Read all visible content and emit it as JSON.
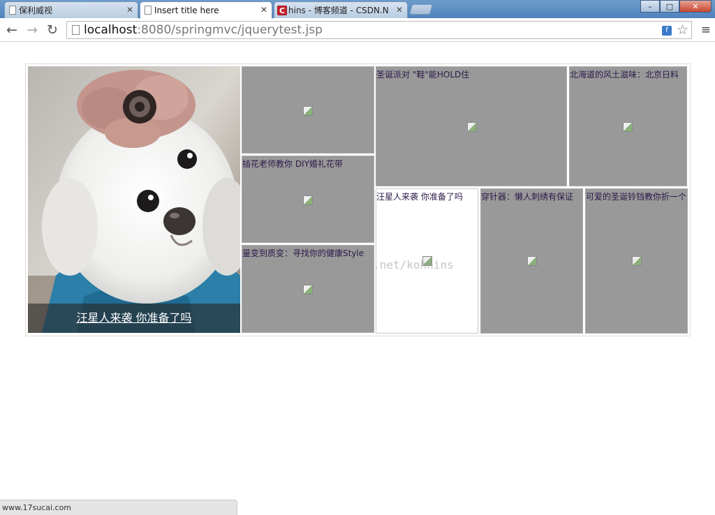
{
  "tabs": [
    {
      "label": "保利威视",
      "active": false
    },
    {
      "label": "Insert title here",
      "active": true
    },
    {
      "label": "hins - 博客频道 - CSDN.N",
      "active": false,
      "favicon": "C"
    }
  ],
  "window_controls": {
    "minimize": "–",
    "maximize": "□",
    "close": "✕"
  },
  "toolbar": {
    "back_icon": "←",
    "forward_icon": "→",
    "reload_icon": "↻",
    "url_host": "localhost",
    "url_rest": ":8080/springmvc/jquerytest.jsp",
    "star_icon": "☆",
    "menu_icon": "≡",
    "extension_icon": "f"
  },
  "hero": {
    "caption": "汪星人来袭 你准备了吗"
  },
  "cells": {
    "cell_a": {
      "title": ""
    },
    "cell_b": {
      "title": "插花老师教你 DIY婚礼花带"
    },
    "cell_c": {
      "title": "量变到质变：寻找你的健康Style"
    },
    "cell_d": {
      "title": "圣诞派对 \"鞋\"能HOLD住"
    },
    "cell_e": {
      "title": "北海道的风土滋味：北京日料"
    },
    "cell_f": {
      "title": "汪星人来袭 你准备了吗"
    },
    "cell_g": {
      "title": "穿针器：懒人刺绣有保证"
    },
    "cell_h": {
      "title": "可爱的圣诞铃铛教你折一个"
    }
  },
  "watermark": "http://blog.csdn.net/kohhins",
  "status_bar": {
    "text": "www.17sucai.com"
  }
}
